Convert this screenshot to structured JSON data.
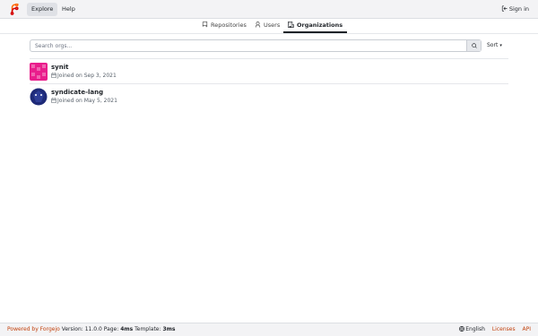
{
  "navbar": {
    "explore_label": "Explore",
    "help_label": "Help",
    "signin_label": "Sign in"
  },
  "tabs": {
    "repositories": "Repositories",
    "users": "Users",
    "organizations": "Organizations"
  },
  "search": {
    "placeholder": "Search orgs...",
    "sort_label": "Sort"
  },
  "orgs": [
    {
      "name": "synit",
      "joined": "Joined on Sep 3, 2021",
      "avatar_color": "#e91e8c"
    },
    {
      "name": "syndicate-lang",
      "joined": "Joined on May 5, 2021",
      "avatar_color": "#1e2a78"
    }
  ],
  "footer": {
    "powered_by": "Powered by Forgejo",
    "version": "Version: 11.0.0",
    "page_label": "Page:",
    "page_time": "4ms",
    "template_label": "Template:",
    "template_time": "3ms",
    "language": "English",
    "licenses": "Licenses",
    "api": "API"
  },
  "colors": {
    "accent": "#c2410c",
    "logo_orange": "#ff6600",
    "logo_red": "#d40000"
  }
}
